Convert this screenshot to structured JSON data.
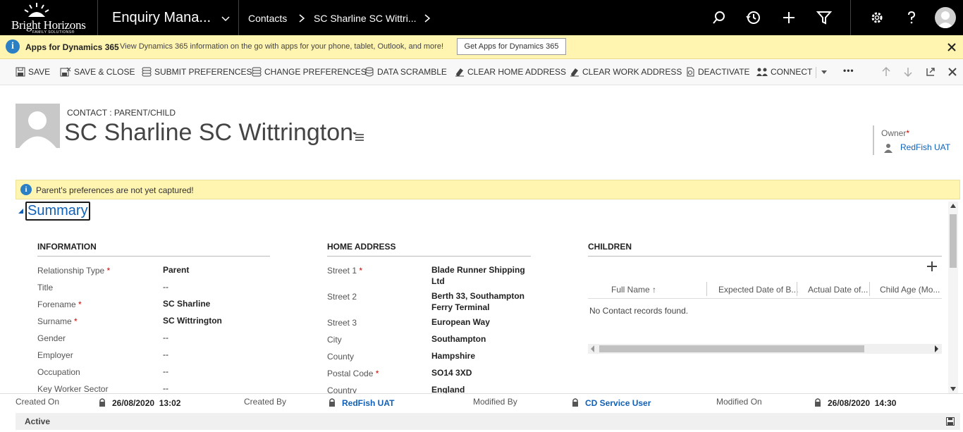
{
  "brand": {
    "name": "Bright Horizons",
    "sub": "FAMILY SOLUTIONS®"
  },
  "nav": {
    "app_title": "Enquiry Mana...",
    "crumb_entity": "Contacts",
    "crumb_record": "SC Sharline SC Wittri...",
    "icons": [
      "search-icon",
      "history-icon",
      "plus-icon",
      "filter-icon",
      "gear-icon",
      "help-icon",
      "user-avatar-icon"
    ]
  },
  "notification": {
    "title": "Apps for Dynamics 365",
    "message": "View Dynamics 365 information on the go with apps for your phone, tablet, Outlook, and more!",
    "button": "Get Apps for Dynamics 365"
  },
  "commands": {
    "save": "SAVE",
    "save_close": "SAVE & CLOSE",
    "submit_prefs": "SUBMIT PREFERENCES",
    "change_prefs": "CHANGE PREFERENCES",
    "data_scramble": "DATA SCRAMBLE",
    "clear_home": "CLEAR HOME ADDRESS",
    "clear_work": "CLEAR WORK ADDRESS",
    "deactivate": "DEACTIVATE",
    "connect": "CONNECT",
    "more": "•••"
  },
  "header": {
    "entity_type": "CONTACT : PARENT/CHILD",
    "record_name": "SC Sharline SC Wittrington",
    "owner_label": "Owner",
    "owner_value": "RedFish UAT"
  },
  "warning": {
    "message": "Parent's preferences are not yet captured!"
  },
  "section": {
    "title": "Summary"
  },
  "information": {
    "heading": "INFORMATION",
    "fields": [
      {
        "label": "Relationship Type",
        "value": "Parent"
      },
      {
        "label": "Title",
        "value": "--"
      },
      {
        "label": "Forename",
        "value": "SC Sharline"
      },
      {
        "label": "Surname",
        "value": "SC Wittrington"
      },
      {
        "label": "Gender",
        "value": "--"
      },
      {
        "label": "Employer",
        "value": "--"
      },
      {
        "label": "Occupation",
        "value": "--"
      },
      {
        "label": "Key Worker Sector",
        "value": "--"
      }
    ]
  },
  "home_address": {
    "heading": "HOME ADDRESS",
    "fields": [
      {
        "label": "Street 1",
        "value": "Blade Runner Shipping Ltd"
      },
      {
        "label": "Street 2",
        "value": "Berth 33, Southampton Ferry Terminal"
      },
      {
        "label": "Street 3",
        "value": "European Way"
      },
      {
        "label": "City",
        "value": "Southampton"
      },
      {
        "label": "County",
        "value": "Hampshire"
      },
      {
        "label": "Postal Code",
        "value": "SO14 3XD"
      },
      {
        "label": "Country",
        "value": "England"
      }
    ]
  },
  "children": {
    "heading": "CHILDREN",
    "columns": [
      "Full Name ↑",
      "Expected Date of B...",
      "Actual Date of...",
      "Child Age (Mo..."
    ],
    "empty": "No Contact records found."
  },
  "footer": {
    "created_on_label": "Created On",
    "created_on": "26/08/2020  13:02",
    "created_by_label": "Created By",
    "created_by": "RedFish UAT",
    "modified_by_label": "Modified By",
    "modified_by": "CD Service User",
    "modified_on_label": "Modified On",
    "modified_on": "26/08/2020  14:30"
  },
  "status": {
    "text": "Active"
  },
  "colors": {
    "nav_bg": "#000000",
    "notif_bg": "#fff4b0",
    "link": "#1160b7",
    "required": "#cc0000"
  }
}
